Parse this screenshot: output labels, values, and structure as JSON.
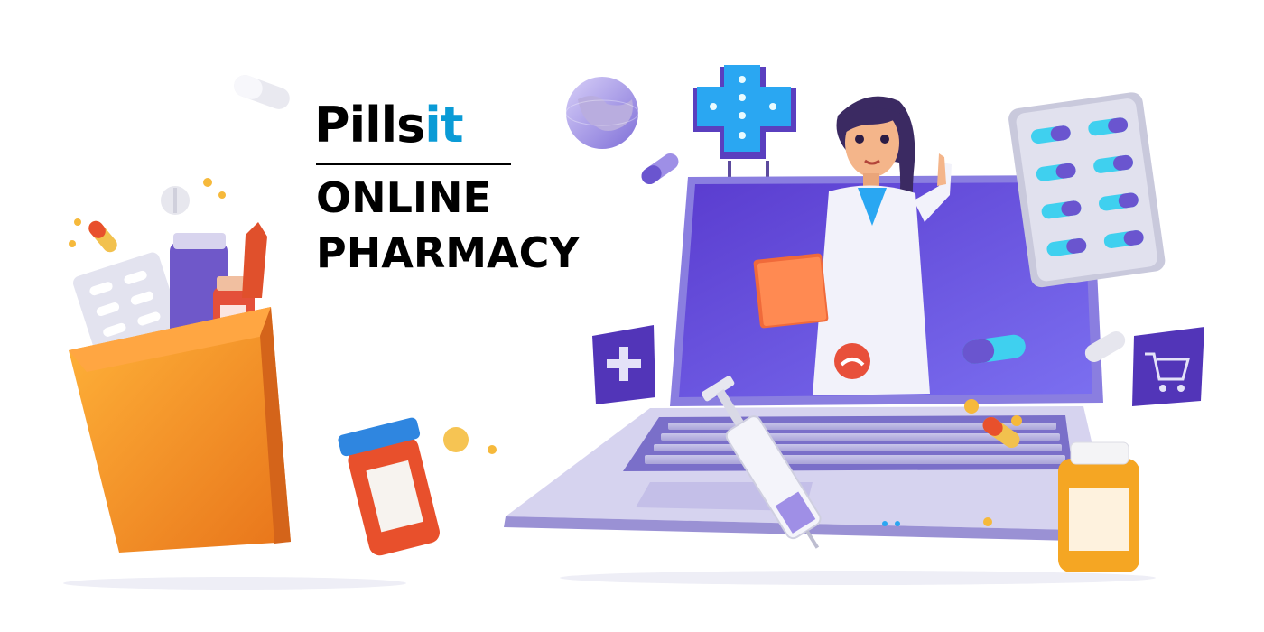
{
  "brand": {
    "name_part1": "Pills",
    "name_part2": "it",
    "tagline_line1": "ONLINE",
    "tagline_line2": "PHARMACY"
  },
  "colors": {
    "brand_black": "#000000",
    "brand_blue": "#0a9bd6",
    "laptop_purple": "#6a4fd8",
    "bag_orange": "#f08a24",
    "cross_blue": "#2aa7f2"
  },
  "icons": [
    "medical-cross-icon",
    "shopping-cart-icon",
    "globe-icon",
    "hang-up-icon"
  ]
}
